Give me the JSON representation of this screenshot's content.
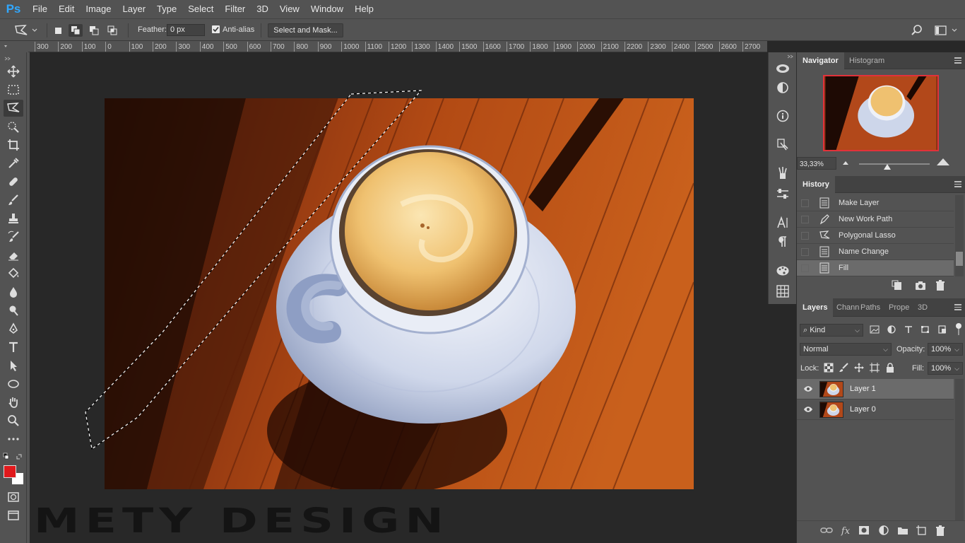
{
  "app": {
    "logo": "Ps"
  },
  "menu": [
    "File",
    "Edit",
    "Image",
    "Layer",
    "Type",
    "Select",
    "Filter",
    "3D",
    "View",
    "Window",
    "Help"
  ],
  "options": {
    "feather_label": "Feather:",
    "feather_value": "0 px",
    "antialias_label": "Anti-alias",
    "antialias_checked": true,
    "select_mask_label": "Select and Mask..."
  },
  "ruler": {
    "labels": [
      "300",
      "200",
      "100",
      "0",
      "100",
      "200",
      "300",
      "400",
      "500",
      "600",
      "700",
      "800",
      "900",
      "1000",
      "1100",
      "1200",
      "1300",
      "1400",
      "1500",
      "1600",
      "1700",
      "1800",
      "1900",
      "2000",
      "2100",
      "2200",
      "2300",
      "2400",
      "2500",
      "2600",
      "2700"
    ]
  },
  "tools": [
    "move-tool",
    "marquee-tool",
    "polygonal-lasso-tool",
    "quick-selection-tool",
    "crop-tool",
    "eyedropper-tool",
    "healing-brush-tool",
    "brush-tool",
    "clone-stamp-tool",
    "history-brush-tool",
    "eraser-tool",
    "paint-bucket-tool",
    "blur-tool",
    "dodge-tool",
    "pen-tool",
    "type-tool",
    "path-selection-tool",
    "ellipse-tool",
    "hand-tool",
    "zoom-tool",
    "more-tools"
  ],
  "colors": {
    "foreground": "#e1191c",
    "background": "#ffffff",
    "accent": "#31a8ff"
  },
  "navigator": {
    "tabs": [
      "Navigator",
      "Histogram"
    ],
    "active_tab": "Navigator",
    "zoom": "33,33%",
    "zoom_slider_fraction": 0.4
  },
  "history": {
    "tab": "History",
    "items": [
      {
        "label": "Make Layer",
        "icon": "document-icon"
      },
      {
        "label": "New Work Path",
        "icon": "pen-icon"
      },
      {
        "label": "Polygonal Lasso",
        "icon": "polygonal-lasso-icon"
      },
      {
        "label": "Name Change",
        "icon": "document-icon"
      },
      {
        "label": "Fill",
        "icon": "document-icon"
      }
    ],
    "active_index": 4
  },
  "layers_panel": {
    "tabs": [
      "Layers",
      "Chann",
      "Paths",
      "Prope",
      "3D"
    ],
    "active_tab": "Layers",
    "kind_label": "Kind",
    "blend_mode": "Normal",
    "opacity_label": "Opacity:",
    "opacity": "100%",
    "lock_label": "Lock:",
    "fill_label": "Fill:",
    "fill": "100%",
    "layers": [
      {
        "name": "Layer 1",
        "visible": true,
        "selected": true
      },
      {
        "name": "Layer 0",
        "visible": true,
        "selected": false
      }
    ]
  },
  "watermark": "METY DESIGN"
}
